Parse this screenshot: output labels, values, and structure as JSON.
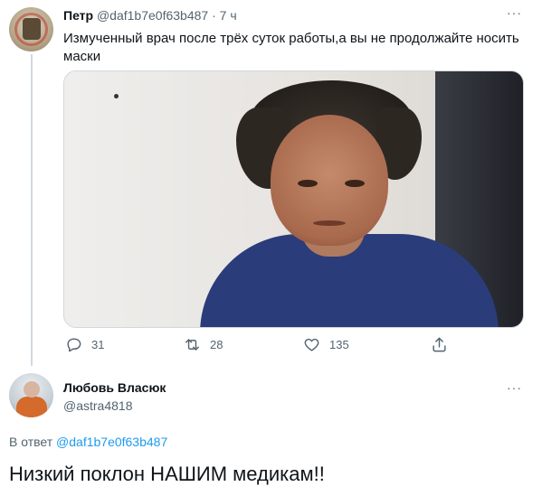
{
  "tweet": {
    "author_name": "Петр",
    "author_handle": "@daf1b7e0f63b487",
    "separator": "·",
    "time": "7 ч",
    "text": "Измученный врач после трёх суток работы,а вы не продолжайте носить маски",
    "media_icon": "photo",
    "actions": {
      "reply_count": "31",
      "retweet_count": "28",
      "like_count": "135"
    }
  },
  "reply": {
    "author_name": "Любовь Власюк",
    "author_handle": "@astra4818",
    "replying_to_prefix": "В ответ",
    "replying_to_handle": "@daf1b7e0f63b487",
    "text": "Низкий поклон НАШИМ медикам!!"
  },
  "more_label": "···",
  "colors": {
    "text": "#0f1419",
    "secondary": "#536471",
    "link": "#1d9bf0",
    "border": "#cfd9de"
  },
  "icons": {
    "reply": "reply-icon",
    "retweet": "retweet-icon",
    "like": "heart-icon",
    "share": "share-icon",
    "more": "more-options-icon"
  }
}
